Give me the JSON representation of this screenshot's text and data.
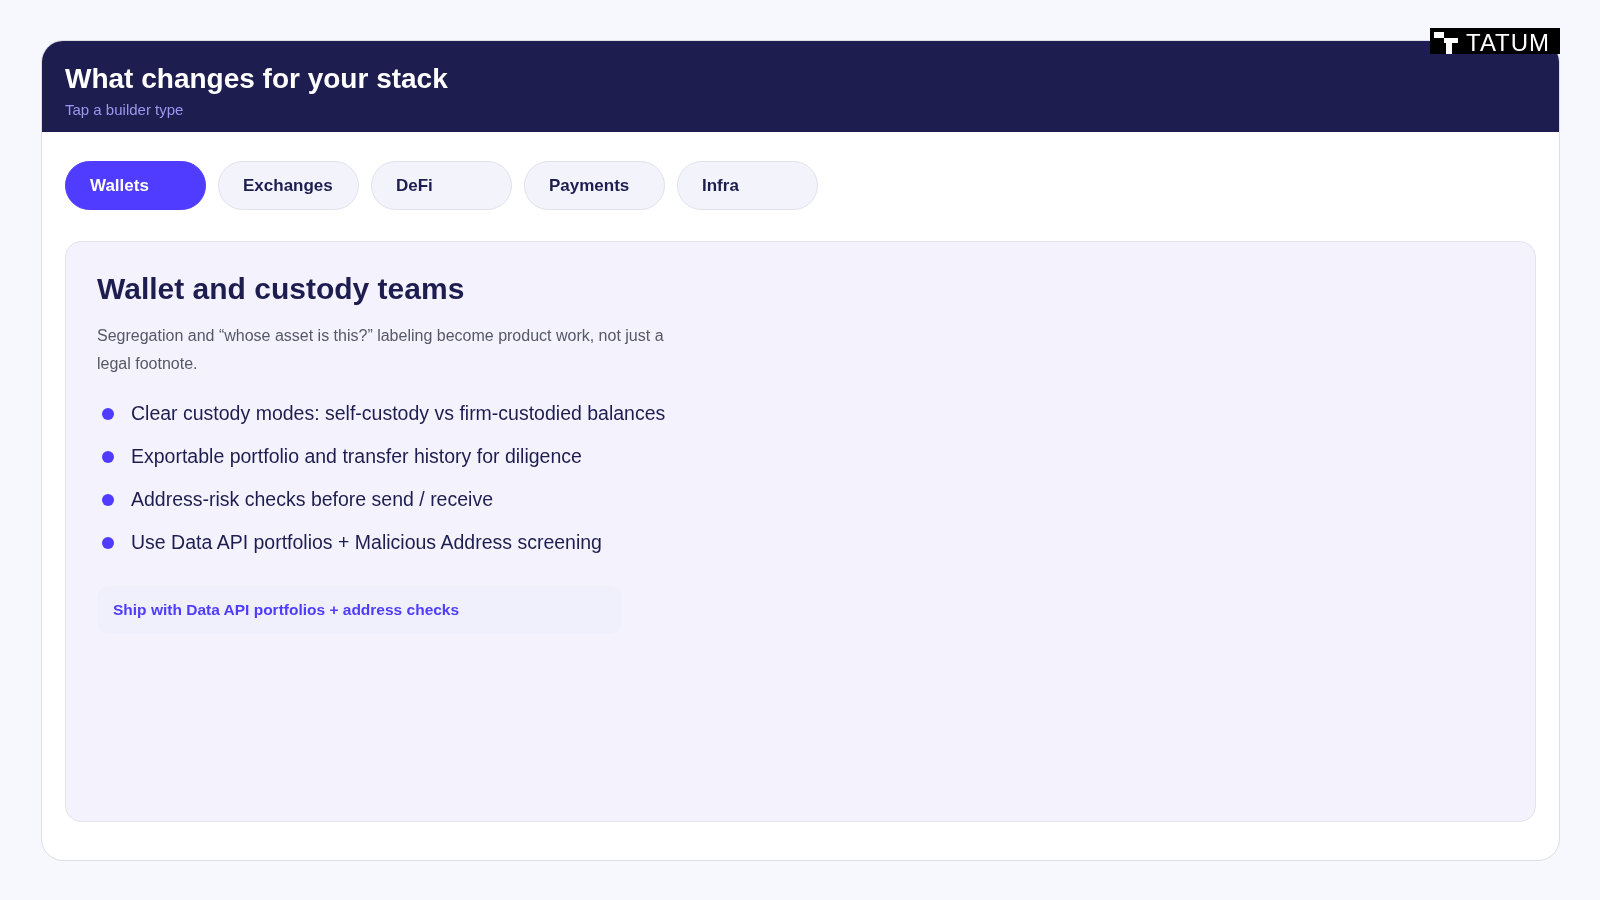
{
  "logo": {
    "text": "TATUM"
  },
  "header": {
    "title": "What changes for your stack",
    "subtitle": "Tap a builder type"
  },
  "tabs": [
    {
      "label": "Wallets",
      "selected": true
    },
    {
      "label": "Exchanges",
      "selected": false
    },
    {
      "label": "DeFi",
      "selected": false
    },
    {
      "label": "Payments",
      "selected": false
    },
    {
      "label": "Infra",
      "selected": false
    }
  ],
  "panel": {
    "title": "Wallet and custody teams",
    "description": "Segregation and “whose asset is this?” labeling become product work, not just a legal footnote.",
    "bullets": [
      "Clear custody modes: self-custody vs firm-custodied balances",
      "Exportable portfolio and transfer history for diligence",
      "Address-risk checks before send / receive",
      "Use Data API portfolios + Malicious Address screening"
    ],
    "cta": "Ship with Data API portfolios + address checks"
  }
}
